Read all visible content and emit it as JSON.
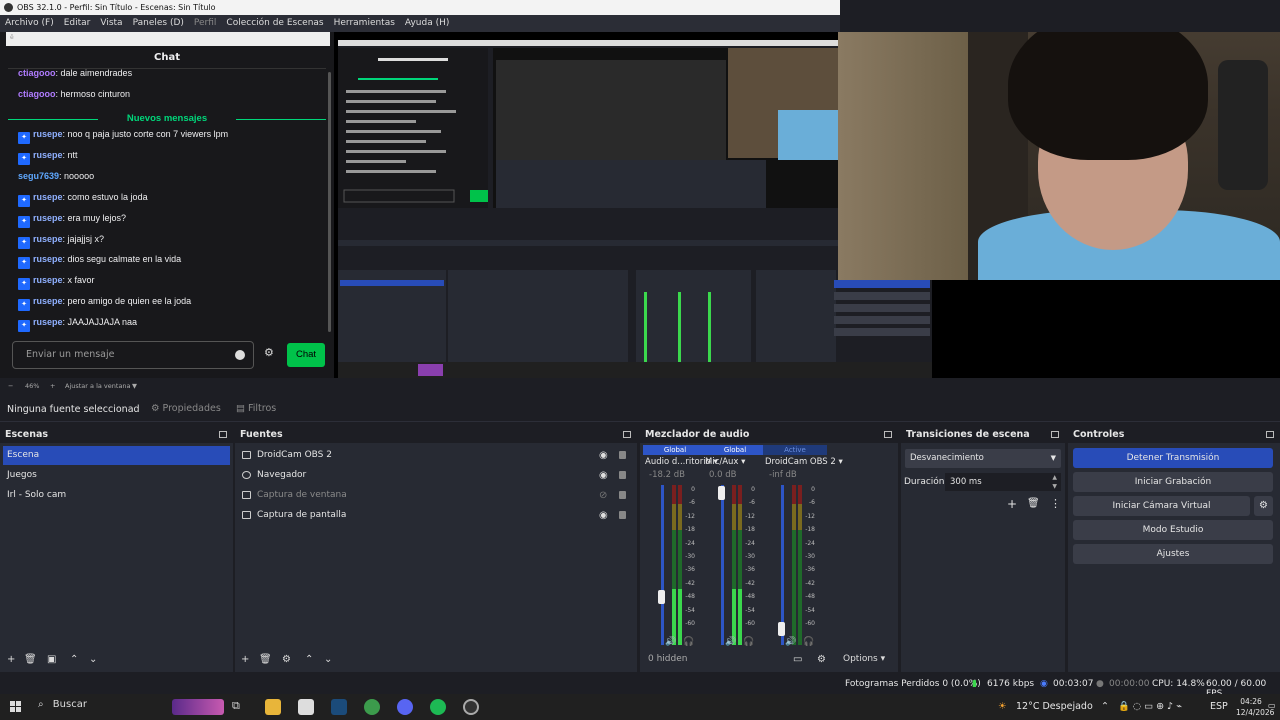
{
  "window": {
    "title": "OBS 32.1.0 - Perfil: Sin Título - Escenas: Sin Título"
  },
  "menu": [
    "Archivo (F)",
    "Editar",
    "Vista",
    "Paneles (D)",
    "Perfil",
    "Colección de Escenas",
    "Herramientas",
    "Ayuda (H)"
  ],
  "chat": {
    "header": "Chat",
    "old_messages": [
      {
        "user": "ctiagooo",
        "text": "dale aimendrades"
      },
      {
        "user": "ctiagooo",
        "text": "hermoso cinturon"
      }
    ],
    "new_label": "Nuevos mensajes",
    "messages": [
      {
        "user": "rusepe",
        "text": "noo q paja justo corte con 7 viewers lpm"
      },
      {
        "user": "rusepe",
        "text": "ntt"
      },
      {
        "user": "segu7639",
        "text": "nooooo"
      },
      {
        "user": "rusepe",
        "text": "como estuvo la joda"
      },
      {
        "user": "rusepe",
        "text": "era muy lejos?"
      },
      {
        "user": "rusepe",
        "text": "jajajjsj x?"
      },
      {
        "user": "rusepe",
        "text": "dios segu calmate en la vida"
      },
      {
        "user": "rusepe",
        "text": "x favor"
      },
      {
        "user": "rusepe",
        "text": "pero amigo de quien ee la joda"
      },
      {
        "user": "rusepe",
        "text": "JAAJAJJAJA naa"
      }
    ],
    "input_placeholder": "Enviar un mensaje",
    "send_label": "Chat"
  },
  "preview": {
    "zoom": "46%",
    "fit": "Ajustar a la ventana"
  },
  "source_toolbar": {
    "selected": "Ninguna fuente seleccionad",
    "properties": "Propiedades",
    "filters": "Filtros"
  },
  "scenes": {
    "title": "Escenas",
    "items": [
      "Escena",
      "Juegos",
      "Irl - Solo cam"
    ]
  },
  "sources": {
    "title": "Fuentes",
    "items": [
      {
        "name": "DroidCam OBS 2",
        "enabled": true
      },
      {
        "name": "Navegador",
        "enabled": true
      },
      {
        "name": "Captura de ventana",
        "enabled": false
      },
      {
        "name": "Captura de pantalla",
        "enabled": true
      }
    ]
  },
  "mixer": {
    "title": "Mezclador de audio",
    "hidden": "0 hidden",
    "options": "Options",
    "scale": [
      "0",
      "-6",
      "-12",
      "-18",
      "-24",
      "-30",
      "-36",
      "-42",
      "-48",
      "-54",
      "-60"
    ],
    "channels": [
      {
        "tag": "Global",
        "name": "Audio d...ritorio",
        "db": "-18.2 dB",
        "level": 0.35,
        "fader": 0.3
      },
      {
        "tag": "Global",
        "name": "Mic/Aux",
        "db": "0.0 dB",
        "level": 0.35,
        "fader": 0.95
      },
      {
        "tag": "Active",
        "name": "DroidCam OBS 2",
        "db": "-inf dB",
        "level": 0.0,
        "fader": 0.1
      }
    ]
  },
  "transitions": {
    "title": "Transiciones de escena",
    "selected": "Desvanecimiento",
    "duration_label": "Duración",
    "duration": "300 ms"
  },
  "controls": {
    "title": "Controles",
    "buttons": [
      "Detener Transmisión",
      "Iniciar Grabación",
      "Iniciar Cámara Virtual",
      "Modo Estudio",
      "Ajustes"
    ]
  },
  "status": {
    "dropped": "Fotogramas Perdidos 0 (0.0%)",
    "bitrate": "6176 kbps",
    "live_time": "00:03:07",
    "rec_time": "00:00:00",
    "cpu": "CPU: 14.8%",
    "fps": "60.00 / 60.00 FPS"
  },
  "taskbar": {
    "search": "Buscar",
    "weather": "12°C  Despejado",
    "lang": "ESP",
    "time": "04:26",
    "date": "12/4/2026"
  }
}
